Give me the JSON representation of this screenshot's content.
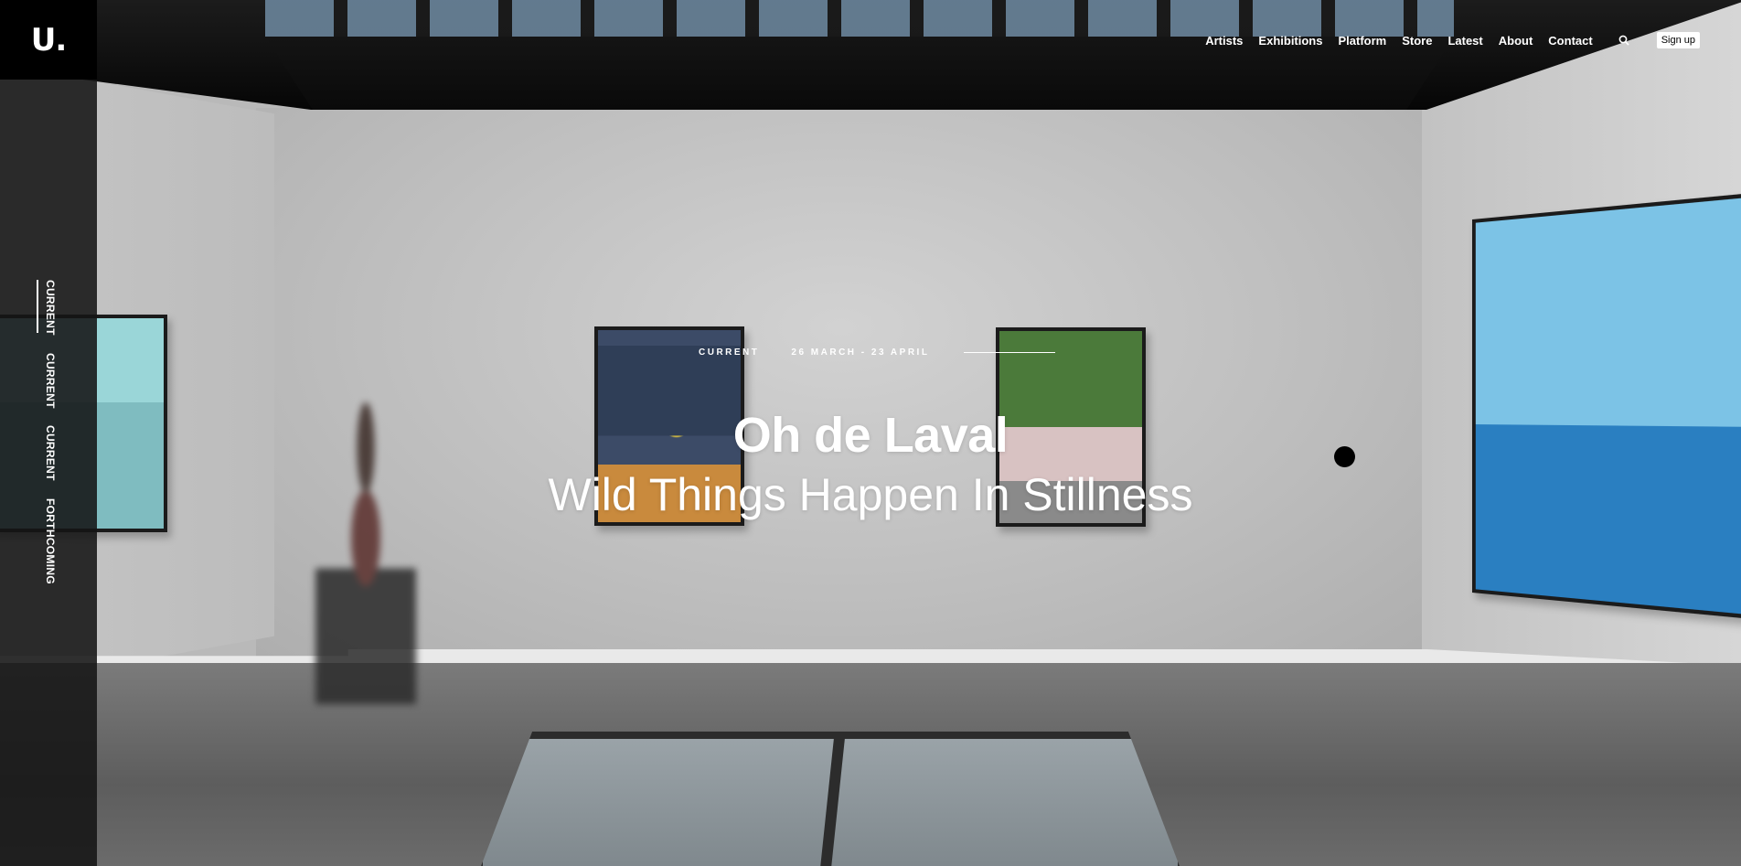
{
  "header": {
    "logo": "U.",
    "nav": [
      {
        "label": "Artists"
      },
      {
        "label": "Exhibitions"
      },
      {
        "label": "Platform"
      },
      {
        "label": "Store"
      },
      {
        "label": "Latest"
      },
      {
        "label": "About"
      },
      {
        "label": "Contact"
      }
    ],
    "search_icon": "search-icon",
    "signup_label": "Sign up"
  },
  "sidebar": {
    "tabs": [
      {
        "label": "CURRENT",
        "active": true
      },
      {
        "label": "CURRENT",
        "active": false
      },
      {
        "label": "CURRENT",
        "active": false
      },
      {
        "label": "FORTHCOMING",
        "active": false
      }
    ]
  },
  "hero": {
    "status": "CURRENT",
    "dates": "26 MARCH - 23 APRIL",
    "artist": "Oh de Laval",
    "title": "Wild Things Happen In Stillness"
  },
  "colors": {
    "text": "#ffffff",
    "sidebar": "#141414",
    "logo_bg": "#000000"
  }
}
